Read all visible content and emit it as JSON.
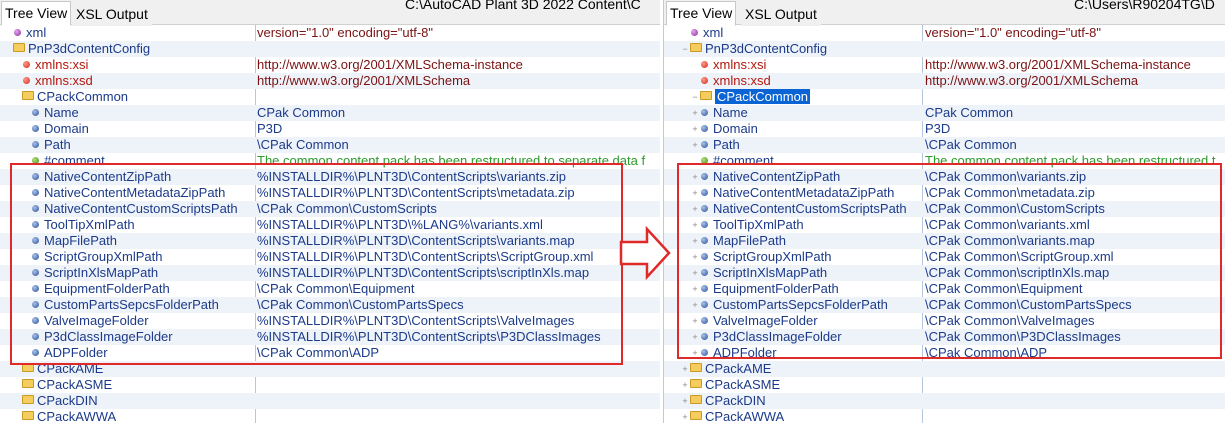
{
  "left": {
    "tabs": [
      "Tree View",
      "XSL Output"
    ],
    "path": "C:\\AutoCAD Plant 3D 2022 Content\\C",
    "rows": [
      {
        "indent": 0,
        "expander": "",
        "icon": "purple",
        "label": "xml",
        "label_type": "node",
        "value": "version=\"1.0\" encoding=\"utf-8\"",
        "value_type": "attr"
      },
      {
        "indent": 0,
        "expander": "",
        "icon": "folder",
        "label": "PnP3dContentConfig",
        "label_type": "node",
        "value": "",
        "value_type": "text"
      },
      {
        "indent": 1,
        "expander": "",
        "icon": "red",
        "label": "xmlns:xsi",
        "label_type": "attr",
        "value": "http://www.w3.org/2001/XMLSchema-instance",
        "value_type": "attr"
      },
      {
        "indent": 1,
        "expander": "",
        "icon": "red",
        "label": "xmlns:xsd",
        "label_type": "attr",
        "value": "http://www.w3.org/2001/XMLSchema",
        "value_type": "attr"
      },
      {
        "indent": 1,
        "expander": "",
        "icon": "folder",
        "label": "CPackCommon",
        "label_type": "node",
        "value": "",
        "value_type": "text"
      },
      {
        "indent": 2,
        "expander": "",
        "icon": "blue",
        "label": "Name",
        "label_type": "node",
        "value": "CPak Common",
        "value_type": "text"
      },
      {
        "indent": 2,
        "expander": "",
        "icon": "blue",
        "label": "Domain",
        "label_type": "node",
        "value": "P3D",
        "value_type": "text"
      },
      {
        "indent": 2,
        "expander": "",
        "icon": "blue",
        "label": "Path",
        "label_type": "node",
        "value": "\\CPak Common",
        "value_type": "text"
      },
      {
        "indent": 2,
        "expander": "",
        "icon": "green",
        "label": "#comment",
        "label_type": "node",
        "value": "The common content pack has been restructured to separate data f",
        "value_type": "comment"
      },
      {
        "indent": 2,
        "expander": "",
        "icon": "blue",
        "label": "NativeContentZipPath",
        "label_type": "node",
        "value": "%INSTALLDIR%\\PLNT3D\\ContentScripts\\variants.zip",
        "value_type": "text"
      },
      {
        "indent": 2,
        "expander": "",
        "icon": "blue",
        "label": "NativeContentMetadataZipPath",
        "label_type": "node",
        "value": "%INSTALLDIR%\\PLNT3D\\ContentScripts\\metadata.zip",
        "value_type": "text"
      },
      {
        "indent": 2,
        "expander": "",
        "icon": "blue",
        "label": "NativeContentCustomScriptsPath",
        "label_type": "node",
        "value": "\\CPak Common\\CustomScripts",
        "value_type": "text"
      },
      {
        "indent": 2,
        "expander": "",
        "icon": "blue",
        "label": "ToolTipXmlPath",
        "label_type": "node",
        "value": "%INSTALLDIR%\\PLNT3D\\%LANG%\\variants.xml",
        "value_type": "text"
      },
      {
        "indent": 2,
        "expander": "",
        "icon": "blue",
        "label": "MapFilePath",
        "label_type": "node",
        "value": "%INSTALLDIR%\\PLNT3D\\ContentScripts\\variants.map",
        "value_type": "text"
      },
      {
        "indent": 2,
        "expander": "",
        "icon": "blue",
        "label": "ScriptGroupXmlPath",
        "label_type": "node",
        "value": "%INSTALLDIR%\\PLNT3D\\ContentScripts\\ScriptGroup.xml",
        "value_type": "text"
      },
      {
        "indent": 2,
        "expander": "",
        "icon": "blue",
        "label": "ScriptInXlsMapPath",
        "label_type": "node",
        "value": "%INSTALLDIR%\\PLNT3D\\ContentScripts\\scriptInXls.map",
        "value_type": "text"
      },
      {
        "indent": 2,
        "expander": "",
        "icon": "blue",
        "label": "EquipmentFolderPath",
        "label_type": "node",
        "value": "\\CPak Common\\Equipment",
        "value_type": "text"
      },
      {
        "indent": 2,
        "expander": "",
        "icon": "blue",
        "label": "CustomPartsSepcsFolderPath",
        "label_type": "node",
        "value": "\\CPak Common\\CustomPartsSpecs",
        "value_type": "text"
      },
      {
        "indent": 2,
        "expander": "",
        "icon": "blue",
        "label": "ValveImageFolder",
        "label_type": "node",
        "value": "%INSTALLDIR%\\PLNT3D\\ContentScripts\\ValveImages",
        "value_type": "text"
      },
      {
        "indent": 2,
        "expander": "",
        "icon": "blue",
        "label": "P3dClassImageFolder",
        "label_type": "node",
        "value": "%INSTALLDIR%\\PLNT3D\\ContentScripts\\P3DClassImages",
        "value_type": "text"
      },
      {
        "indent": 2,
        "expander": "",
        "icon": "blue",
        "label": "ADPFolder",
        "label_type": "node",
        "value": "\\CPak Common\\ADP",
        "value_type": "text"
      },
      {
        "indent": 1,
        "expander": "",
        "icon": "folder",
        "label": "CPackAME",
        "label_type": "node",
        "value": "",
        "value_type": "text"
      },
      {
        "indent": 1,
        "expander": "",
        "icon": "folder",
        "label": "CPackASME",
        "label_type": "node",
        "value": "",
        "value_type": "text"
      },
      {
        "indent": 1,
        "expander": "",
        "icon": "folder",
        "label": "CPackDIN",
        "label_type": "node",
        "value": "",
        "value_type": "text"
      },
      {
        "indent": 1,
        "expander": "",
        "icon": "folder",
        "label": "CPackAWWA",
        "label_type": "node",
        "value": "",
        "value_type": "text"
      }
    ]
  },
  "right": {
    "tabs": [
      "Tree View",
      "XSL Output"
    ],
    "path": "C:\\Users\\R90204TG\\D",
    "rows": [
      {
        "indent": 0,
        "expander": "",
        "icon": "purple",
        "label": "xml",
        "label_type": "node",
        "value": "version=\"1.0\" encoding=\"utf-8\"",
        "value_type": "attr"
      },
      {
        "indent": 0,
        "expander": "−",
        "icon": "folder",
        "label": "PnP3dContentConfig",
        "label_type": "node",
        "value": "",
        "value_type": "text"
      },
      {
        "indent": 1,
        "expander": "",
        "icon": "red",
        "label": "xmlns:xsi",
        "label_type": "attr",
        "value": "http://www.w3.org/2001/XMLSchema-instance",
        "value_type": "attr"
      },
      {
        "indent": 1,
        "expander": "",
        "icon": "red",
        "label": "xmlns:xsd",
        "label_type": "attr",
        "value": "http://www.w3.org/2001/XMLSchema",
        "value_type": "attr"
      },
      {
        "indent": 1,
        "expander": "−",
        "icon": "folder",
        "label": "CPackCommon",
        "label_type": "selected",
        "value": "",
        "value_type": "text"
      },
      {
        "indent": 1,
        "expander": "+",
        "icon": "blue",
        "label": "Name",
        "label_type": "node",
        "value": "CPak Common",
        "value_type": "text"
      },
      {
        "indent": 1,
        "expander": "+",
        "icon": "blue",
        "label": "Domain",
        "label_type": "node",
        "value": "P3D",
        "value_type": "text"
      },
      {
        "indent": 1,
        "expander": "+",
        "icon": "blue",
        "label": "Path",
        "label_type": "node",
        "value": "\\CPak Common",
        "value_type": "text"
      },
      {
        "indent": 1,
        "expander": "",
        "icon": "green",
        "label": "#comment",
        "label_type": "node",
        "value": "The common content pack has been restructured t",
        "value_type": "comment"
      },
      {
        "indent": 1,
        "expander": "+",
        "icon": "blue",
        "label": "NativeContentZipPath",
        "label_type": "node",
        "value": "\\CPak Common\\variants.zip",
        "value_type": "text"
      },
      {
        "indent": 1,
        "expander": "+",
        "icon": "blue",
        "label": "NativeContentMetadataZipPath",
        "label_type": "node",
        "value": "\\CPak Common\\metadata.zip",
        "value_type": "text"
      },
      {
        "indent": 1,
        "expander": "+",
        "icon": "blue",
        "label": "NativeContentCustomScriptsPath",
        "label_type": "node",
        "value": "\\CPak Common\\CustomScripts",
        "value_type": "text"
      },
      {
        "indent": 1,
        "expander": "+",
        "icon": "blue",
        "label": "ToolTipXmlPath",
        "label_type": "node",
        "value": "\\CPak Common\\variants.xml",
        "value_type": "text"
      },
      {
        "indent": 1,
        "expander": "+",
        "icon": "blue",
        "label": "MapFilePath",
        "label_type": "node",
        "value": "\\CPak Common\\variants.map",
        "value_type": "text"
      },
      {
        "indent": 1,
        "expander": "+",
        "icon": "blue",
        "label": "ScriptGroupXmlPath",
        "label_type": "node",
        "value": "\\CPak Common\\ScriptGroup.xml",
        "value_type": "text"
      },
      {
        "indent": 1,
        "expander": "+",
        "icon": "blue",
        "label": "ScriptInXlsMapPath",
        "label_type": "node",
        "value": "\\CPak Common\\scriptInXls.map",
        "value_type": "text"
      },
      {
        "indent": 1,
        "expander": "+",
        "icon": "blue",
        "label": "EquipmentFolderPath",
        "label_type": "node",
        "value": "\\CPak Common\\Equipment",
        "value_type": "text"
      },
      {
        "indent": 1,
        "expander": "+",
        "icon": "blue",
        "label": "CustomPartsSepcsFolderPath",
        "label_type": "node",
        "value": "\\CPak Common\\CustomPartsSpecs",
        "value_type": "text"
      },
      {
        "indent": 1,
        "expander": "+",
        "icon": "blue",
        "label": "ValveImageFolder",
        "label_type": "node",
        "value": "\\CPak Common\\ValveImages",
        "value_type": "text"
      },
      {
        "indent": 1,
        "expander": "+",
        "icon": "blue",
        "label": "P3dClassImageFolder",
        "label_type": "node",
        "value": "\\CPak Common\\P3DClassImages",
        "value_type": "text"
      },
      {
        "indent": 1,
        "expander": "+",
        "icon": "blue",
        "label": "ADPFolder",
        "label_type": "node",
        "value": "\\CPak Common\\ADP",
        "value_type": "text"
      },
      {
        "indent": 0,
        "expander": "+",
        "icon": "folder",
        "label": "CPackAME",
        "label_type": "node",
        "value": "",
        "value_type": "text"
      },
      {
        "indent": 0,
        "expander": "+",
        "icon": "folder",
        "label": "CPackASME",
        "label_type": "node",
        "value": "",
        "value_type": "text"
      },
      {
        "indent": 0,
        "expander": "+",
        "icon": "folder",
        "label": "CPackDIN",
        "label_type": "node",
        "value": "",
        "value_type": "text"
      },
      {
        "indent": 0,
        "expander": "+",
        "icon": "folder",
        "label": "CPackAWWA",
        "label_type": "node",
        "value": "",
        "value_type": "text"
      }
    ]
  },
  "colors": {
    "highlight_box": "#e02a2a",
    "selection": "#0a64d4",
    "node_text": "#1b3a8a",
    "attribute_text": "#b4170d",
    "comment_text": "#2c9a2c"
  }
}
